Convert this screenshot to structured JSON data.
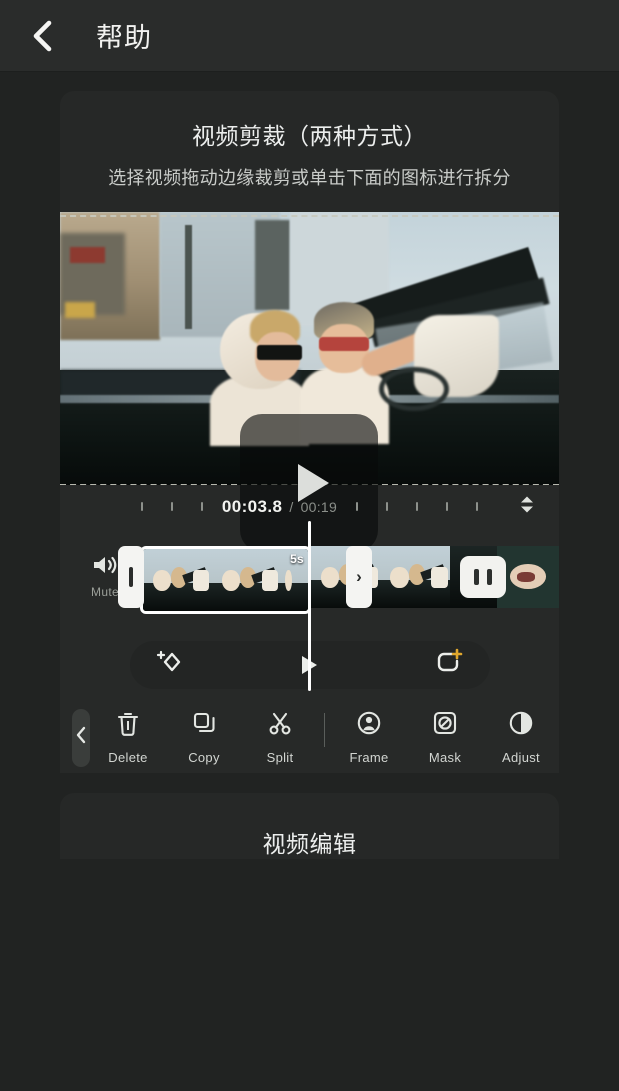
{
  "header": {
    "back_icon": "chevron-left-icon",
    "title": "帮助"
  },
  "card1": {
    "title": "视频剪裁（两种方式）",
    "description": "选择视频拖动边缘裁剪或单击下面的图标进行拆分",
    "preview": {
      "play_icon": "play-icon",
      "crop_guides": "dashed-crop-lines"
    },
    "timeline": {
      "current_time": "00:03.8",
      "separator": "/",
      "total_time": "00:19",
      "expand_icon": "expand-collapse-icon",
      "mute_label": "Mute",
      "mute_icon": "speaker-icon",
      "clip_duration_badge": "5s",
      "left_handle_icon": "trim-handle-left",
      "right_handle_icon": "trim-handle-right-chevron",
      "transition_icon": "transition-icon"
    },
    "control_bar": {
      "keyframe_label": "add-keyframe-icon",
      "play_label": "play-icon",
      "add_clip_label": "add-clip-icon"
    },
    "toolbar": {
      "collapse_icon": "chevron-left-icon",
      "items": [
        {
          "label": "Delete",
          "icon": "trash-icon"
        },
        {
          "label": "Copy",
          "icon": "copy-icon"
        },
        {
          "label": "Split",
          "icon": "scissors-icon"
        },
        {
          "label": "Frame",
          "icon": "person-frame-icon"
        },
        {
          "label": "Mask",
          "icon": "mask-icon"
        },
        {
          "label": "Adjust",
          "icon": "contrast-icon"
        }
      ]
    }
  },
  "card2": {
    "title": "视频编辑"
  },
  "colors": {
    "background": "#212322",
    "card": "#262827",
    "header": "#2a2c2b",
    "accent_gold": "#e0a82e",
    "text_primary": "#eceeed",
    "text_secondary": "#c9ccc9"
  }
}
